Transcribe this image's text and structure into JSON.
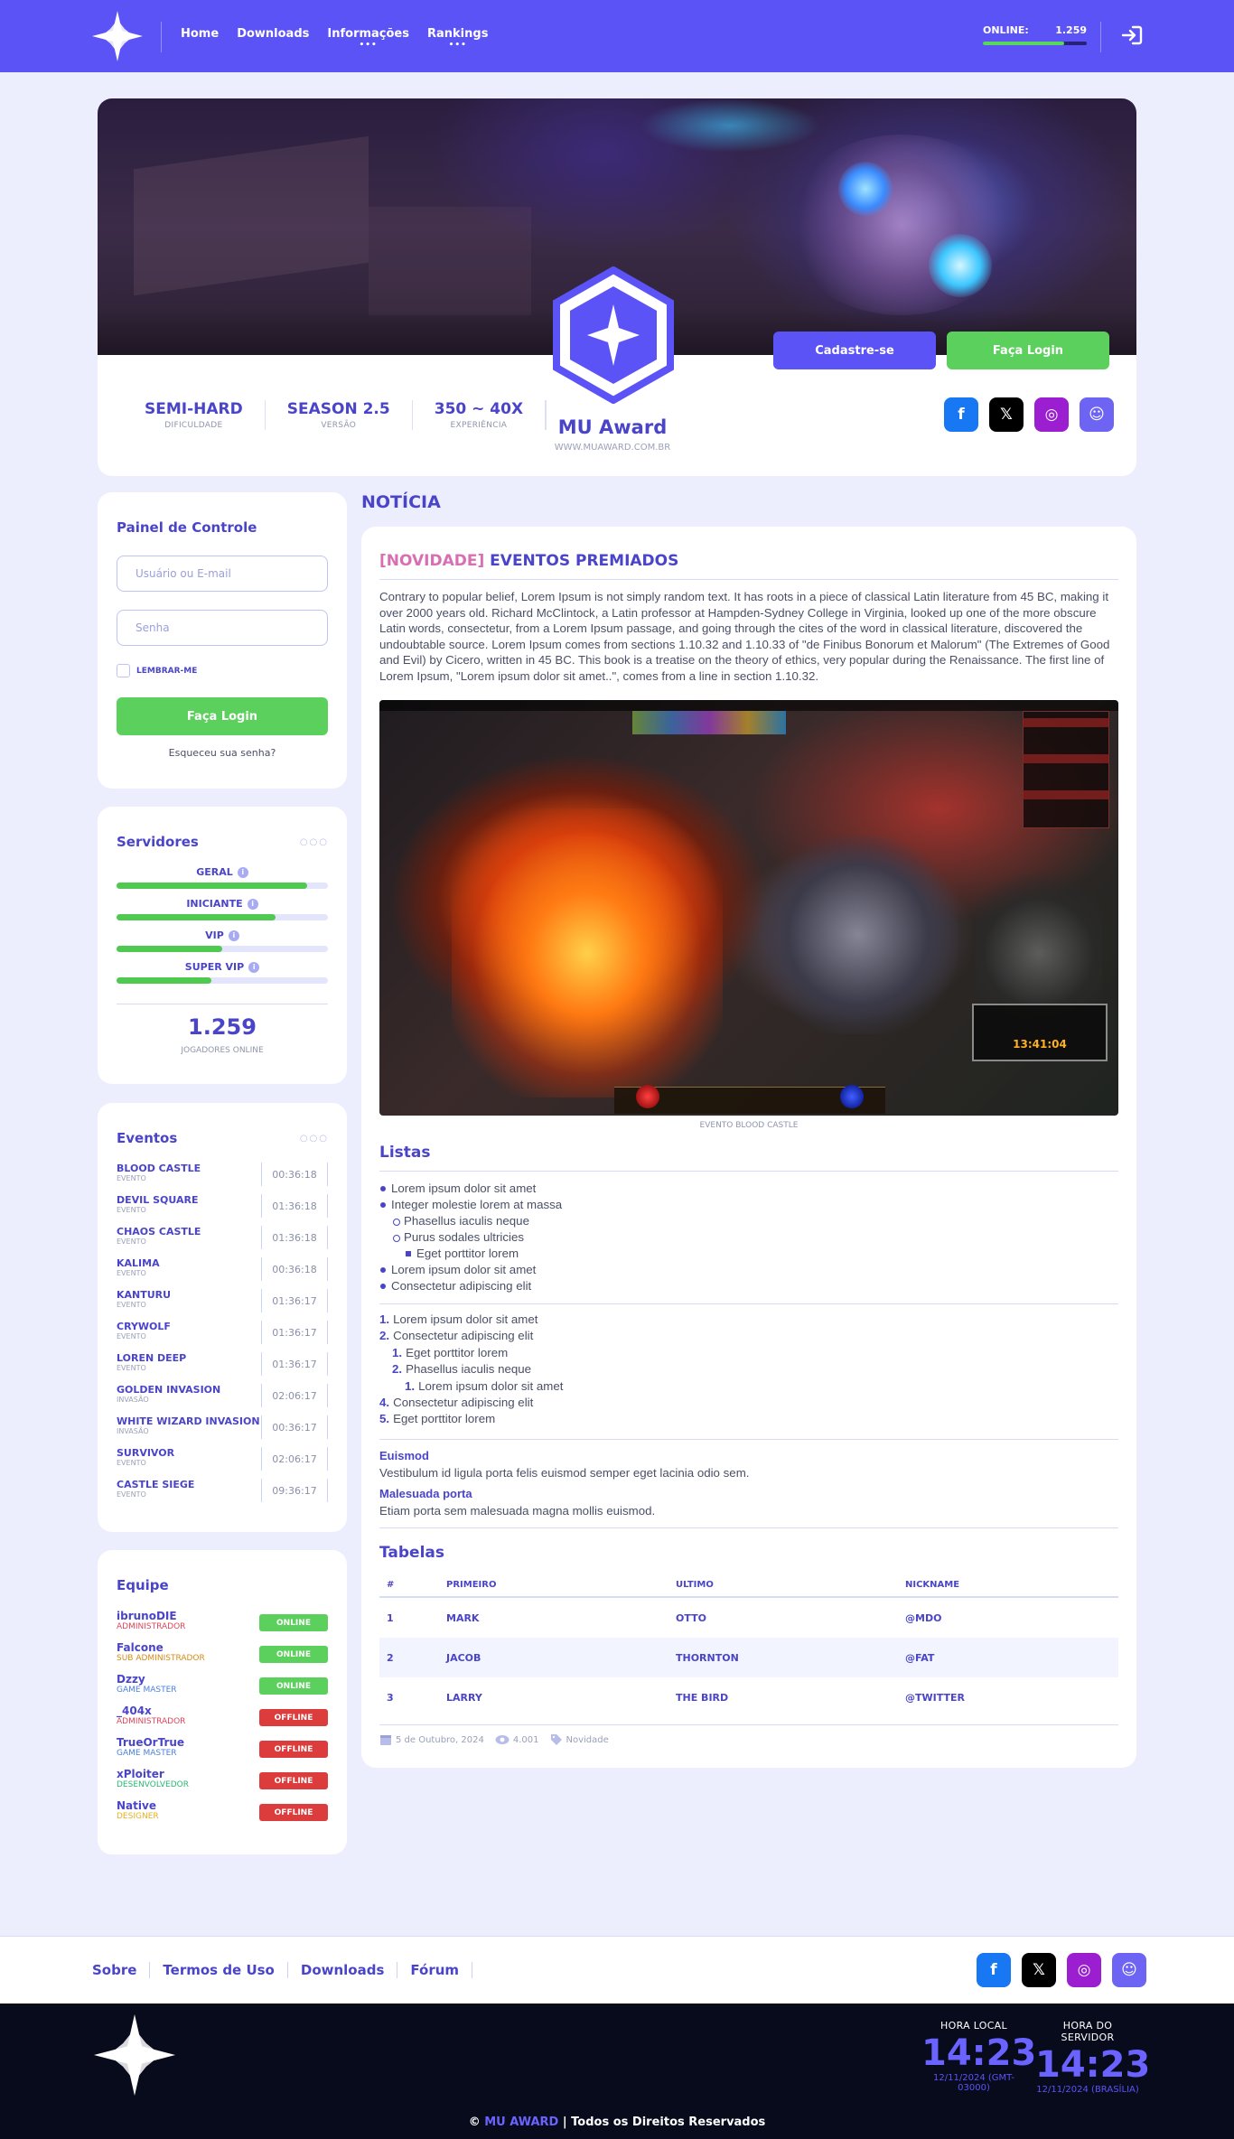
{
  "nav": {
    "items": [
      {
        "label": "Home",
        "dots": ""
      },
      {
        "label": "Downloads",
        "dots": ""
      },
      {
        "label": "Informações",
        "dots": "•••"
      },
      {
        "label": "Rankings",
        "dots": "•••"
      }
    ],
    "online_label": "ONLINE:",
    "online_count": "1.259",
    "online_fraction": 0.78
  },
  "hero": {
    "register_label": "Cadastre-se",
    "login_label": "Faça Login",
    "server_name": "MU Award",
    "server_url": "WWW.MUAWARD.COM.BR",
    "stats": [
      {
        "value": "SEMI-HARD",
        "key": "DIFICULDADE"
      },
      {
        "value": "SEASON 2.5",
        "key": "VERSÃO"
      },
      {
        "value": "350 ~ 40X",
        "key": "EXPERIÊNCIA"
      }
    ],
    "social": [
      {
        "icon": "facebook-icon",
        "glyph": "f"
      },
      {
        "icon": "x-icon",
        "glyph": "𝕏"
      },
      {
        "icon": "instagram-icon",
        "glyph": "◎"
      },
      {
        "icon": "discord-icon",
        "glyph": "☺"
      }
    ]
  },
  "login_panel": {
    "title": "Painel de Controle",
    "user_placeholder": "Usuário ou E-mail",
    "pass_placeholder": "Senha",
    "remember": "LEMBRAR-ME",
    "submit": "Faça Login",
    "forgot": "Esqueceu sua senha?"
  },
  "servers": {
    "title": "Servidores",
    "list": [
      {
        "name": "GERAL",
        "fill": 0.9
      },
      {
        "name": "INICIANTE",
        "fill": 0.75
      },
      {
        "name": "VIP",
        "fill": 0.5
      },
      {
        "name": "SUPER VIP",
        "fill": 0.45
      }
    ],
    "total": "1.259",
    "total_label": "JOGADORES ONLINE"
  },
  "events": {
    "title": "Eventos",
    "list": [
      {
        "name": "BLOOD CASTLE",
        "type": "EVENTO",
        "time": "00:36:18"
      },
      {
        "name": "DEVIL SQUARE",
        "type": "EVENTO",
        "time": "01:36:18"
      },
      {
        "name": "CHAOS CASTLE",
        "type": "EVENTO",
        "time": "01:36:18"
      },
      {
        "name": "KALIMA",
        "type": "EVENTO",
        "time": "00:36:18"
      },
      {
        "name": "KANTURU",
        "type": "EVENTO",
        "time": "01:36:17"
      },
      {
        "name": "CRYWOLF",
        "type": "EVENTO",
        "time": "01:36:17"
      },
      {
        "name": "LOREN DEEP",
        "type": "EVENTO",
        "time": "01:36:17"
      },
      {
        "name": "GOLDEN INVASION",
        "type": "INVASÃO",
        "time": "02:06:17"
      },
      {
        "name": "WHITE WIZARD INVASION",
        "type": "INVASÃO",
        "time": "00:36:17"
      },
      {
        "name": "SURVIVOR",
        "type": "EVENTO",
        "time": "02:06:17"
      },
      {
        "name": "CASTLE SIEGE",
        "type": "EVENTO",
        "time": "09:36:17"
      }
    ]
  },
  "team": {
    "title": "Equipe",
    "list": [
      {
        "name": "ibrunoDIE",
        "role": "ADMINISTRADOR",
        "role_color": "#e0455a",
        "status": "ONLINE",
        "status_color": "#5bd05c"
      },
      {
        "name": "Falcone",
        "role": "SUB ADMINISTRADOR",
        "role_color": "#d68a1a",
        "status": "ONLINE",
        "status_color": "#5bd05c"
      },
      {
        "name": "Dzzy",
        "role": "GAME MASTER",
        "role_color": "#4a7fe0",
        "status": "ONLINE",
        "status_color": "#5bd05c"
      },
      {
        "name": "_404x",
        "role": "ADMINISTRADOR",
        "role_color": "#e0455a",
        "status": "OFFLINE",
        "status_color": "#dc3c3c"
      },
      {
        "name": "TrueOrTrue",
        "role": "GAME MASTER",
        "role_color": "#4a7fe0",
        "status": "OFFLINE",
        "status_color": "#dc3c3c"
      },
      {
        "name": "xPloiter",
        "role": "DESENVOLVEDOR",
        "role_color": "#2bb673",
        "status": "OFFLINE",
        "status_color": "#dc3c3c"
      },
      {
        "name": "Native",
        "role": "DESIGNER",
        "role_color": "#e6b020",
        "status": "OFFLINE",
        "status_color": "#dc3c3c"
      }
    ]
  },
  "news": {
    "section": "NOTÍCIA",
    "tag": "[NOVIDADE]",
    "title": "EVENTOS PREMIADOS",
    "body": "Contrary to popular belief, Lorem Ipsum is not simply random text. It has roots in a piece of classical Latin literature from 45 BC, making it over 2000 years old. Richard McClintock, a Latin professor at Hampden-Sydney College in Virginia, looked up one of the more obscure Latin words, consectetur, from a Lorem Ipsum passage, and going through the cites of the word in classical literature, discovered the undoubtable source. Lorem Ipsum comes from sections 1.10.32 and 1.10.33 of \"de Finibus Bonorum et Malorum\" (The Extremes of Good and Evil) by Cicero, written in 45 BC. This book is a treatise on the theory of ethics, very popular during the Renaissance. The first line of Lorem Ipsum, \"Lorem ipsum dolor sit amet..\", comes from a line in section 1.10.32.",
    "image_caption": "EVENTO BLOOD CASTLE",
    "game_timer": "13:41:04",
    "lists_title": "Listas",
    "ul": [
      "Lorem ipsum dolor sit amet",
      "Integer molestie lorem at massa",
      "Phasellus iaculis neque",
      "Purus sodales ultricies",
      "Eget porttitor lorem",
      "Lorem ipsum dolor sit amet",
      "Consectetur adipiscing elit"
    ],
    "ol": [
      {
        "n": "1.",
        "t": "Lorem ipsum dolor sit amet"
      },
      {
        "n": "2.",
        "t": "Consectetur adipiscing elit"
      },
      {
        "n": "1.",
        "t": "Eget porttitor lorem"
      },
      {
        "n": "2.",
        "t": "Phasellus iaculis neque"
      },
      {
        "n": "1.",
        "t": "Lorem ipsum dolor sit amet"
      },
      {
        "n": "4.",
        "t": "Consectetur adipiscing elit"
      },
      {
        "n": "5.",
        "t": "Eget porttitor lorem"
      }
    ],
    "dl": [
      {
        "term": "Euismod",
        "desc": "Vestibulum id ligula porta felis euismod semper eget lacinia odio sem."
      },
      {
        "term": "Malesuada porta",
        "desc": "Etiam porta sem malesuada magna mollis euismod."
      }
    ],
    "tables_title": "Tabelas",
    "table": {
      "headers": [
        "#",
        "PRIMEIRO",
        "ULTIMO",
        "NICKNAME"
      ],
      "rows": [
        [
          "1",
          "MARK",
          "OTTO",
          "@MDO"
        ],
        [
          "2",
          "JACOB",
          "THORNTON",
          "@FAT"
        ],
        [
          "3",
          "LARRY",
          "THE BIRD",
          "@TWITTER"
        ]
      ]
    },
    "date": "5 de Outubro, 2024",
    "views": "4.001",
    "category": "Novidade"
  },
  "footer": {
    "links": [
      "Sobre",
      "Termos de Uso",
      "Downloads",
      "Fórum"
    ],
    "local_label": "HORA LOCAL",
    "local_time": "14:23",
    "local_date": "12/11/2024 (GMT-03000)",
    "server_label": "HORA DO SERVIDOR",
    "server_time": "14:23",
    "server_date": "12/11/2024 (BRASÍLIA)",
    "copy_prefix": "©",
    "copy_brand": "MU AWARD",
    "copy_suffix": "| Todos os Direitos Reservados"
  }
}
